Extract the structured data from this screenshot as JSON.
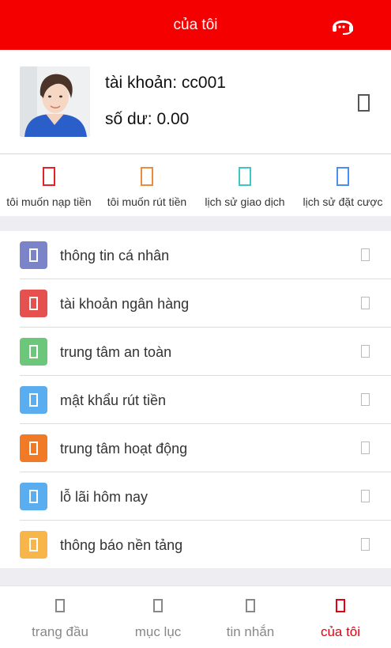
{
  "header": {
    "title": "của tôi",
    "support_icon": "headset-icon"
  },
  "profile": {
    "account_label": "tài khoản:",
    "account_value": "cc001",
    "balance_label": "số dư:",
    "balance_value": "0.00",
    "avatar": "user-avatar-photo"
  },
  "quick_actions": [
    {
      "label": "tôi muốn nạp tiền",
      "color": "#e8202a",
      "icon": "deposit-icon"
    },
    {
      "label": "tôi muốn rút tiền",
      "color": "#ef8a3a",
      "icon": "withdraw-icon"
    },
    {
      "label": "lịch sử giao dịch",
      "color": "#3cc7c4",
      "icon": "transactions-icon"
    },
    {
      "label": "lịch sử đặt cược",
      "color": "#4a8ff0",
      "icon": "bet-history-icon"
    }
  ],
  "menu": [
    {
      "label": "thông tin cá nhân",
      "color": "#7b84c9",
      "icon": "personal-info-icon"
    },
    {
      "label": "tài khoản ngân hàng",
      "color": "#e5514f",
      "icon": "bank-account-icon"
    },
    {
      "label": "trung tâm an toàn",
      "color": "#6cc77a",
      "icon": "security-icon"
    },
    {
      "label": "mật khẩu rút tiền",
      "color": "#5aaef0",
      "icon": "withdraw-password-icon"
    },
    {
      "label": "trung tâm hoạt động",
      "color": "#f07a26",
      "icon": "activity-icon"
    },
    {
      "label": "lỗ lãi hôm nay",
      "color": "#5aaef0",
      "icon": "profit-loss-icon"
    },
    {
      "label": "thông báo nền tảng",
      "color": "#f8b54a",
      "icon": "announcement-icon"
    }
  ],
  "tabbar": {
    "active_color": "#e60012",
    "tabs": [
      {
        "label": "trang đầu",
        "icon": "home-icon",
        "active": false
      },
      {
        "label": "mục lục",
        "icon": "catalog-icon",
        "active": false
      },
      {
        "label": "tin nhắn",
        "icon": "message-icon",
        "active": false
      },
      {
        "label": "của tôi",
        "icon": "profile-icon",
        "active": true
      }
    ]
  }
}
